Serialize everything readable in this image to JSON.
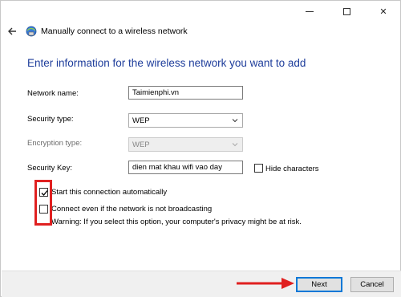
{
  "window": {
    "title": "Manually connect to a wireless network",
    "caption_close": "✕"
  },
  "heading": "Enter information for the wireless network you want to add",
  "form": {
    "network_name_label": "Network name:",
    "network_name_value": "Taimienphi.vn",
    "security_type_label": "Security type:",
    "security_type_value": "WEP",
    "encryption_type_label": "Encryption type:",
    "encryption_type_value": "WEP",
    "security_key_label": "Security Key:",
    "security_key_value": "dien mat khau wifi vao day",
    "hide_characters_label": "Hide characters",
    "hide_characters_checked": false
  },
  "options": {
    "start_auto_label": "Start this connection automatically",
    "start_auto_checked": true,
    "connect_hidden_label": "Connect even if the network is not broadcasting",
    "connect_hidden_checked": false,
    "warning_text": "Warning: If you select this option, your computer's privacy might be at risk."
  },
  "buttons": {
    "next_label": "Next",
    "cancel_label": "Cancel"
  },
  "colors": {
    "heading": "#1e3d9b",
    "highlight": "#e02020",
    "focus_border": "#0078d7"
  },
  "icons": [
    "back-arrow-icon",
    "wireless-network-icon",
    "minimize-icon",
    "maximize-icon",
    "close-icon",
    "chevron-down-icon",
    "checkmark-icon"
  ]
}
